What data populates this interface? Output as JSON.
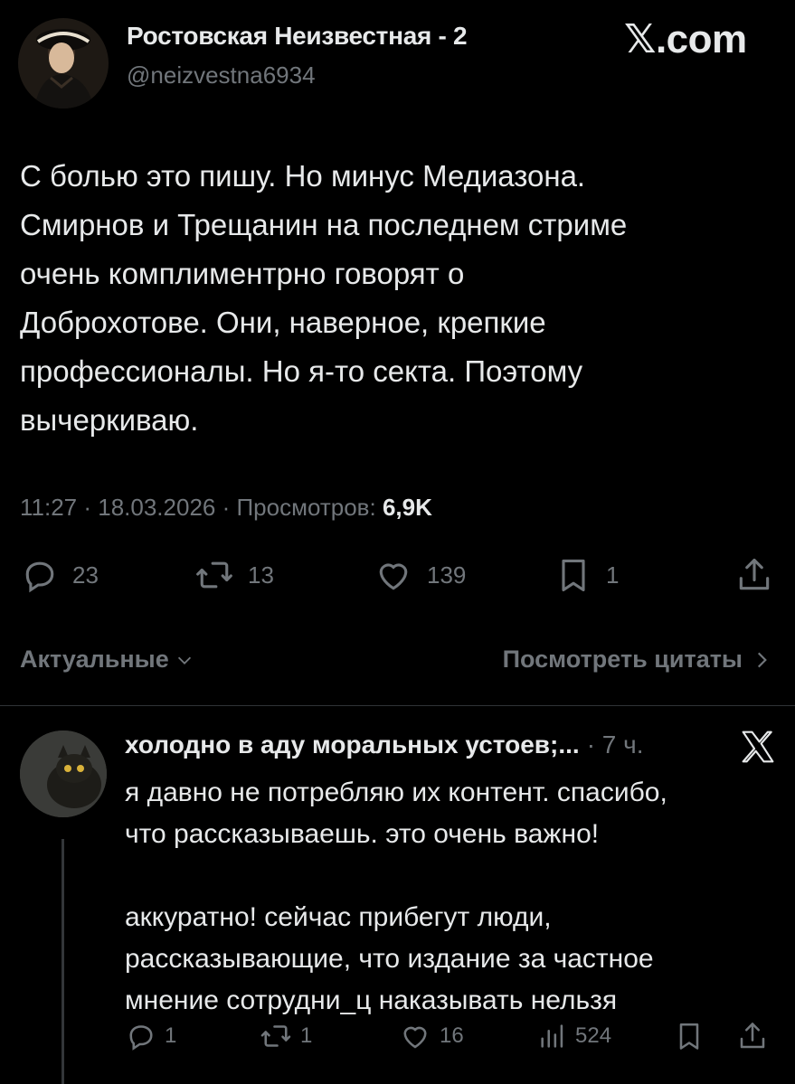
{
  "post": {
    "author_name": "Ростовская Неизвестная - 2",
    "author_handle": "@neizvestna6934",
    "brand": "𝕏.com",
    "text": "С болью это пишу. Но минус Медиазона.\nСмирнов и Трещанин на последнем стриме\nочень комплиментрно говорят о\nДоброхотове. Они, наверное, крепкие\nпрофессионалы. Но я-то секта. Поэтому\nвычеркиваю.",
    "timestamp": "11:27 · 18.03.2026 · Просмотров:",
    "views": "6,9K",
    "actions": {
      "replies": "23",
      "reposts": "13",
      "likes": "139",
      "bookmarks": "1"
    }
  },
  "controls": {
    "sort_label": "Актуальные",
    "quotes_link": "Посмотреть цитаты"
  },
  "reply": {
    "author_name": "холодно в аду моральных устоев;...",
    "time": "· 7 ч.",
    "text": "я давно не потребляю их контент. спасибо,\nчто рассказываешь. это очень важно!\n\nаккуратно! сейчас прибегут люди,\nрассказывающие, что издание за частное\nмнение сотрудни_ц наказывать нельзя",
    "actions": {
      "replies": "1",
      "reposts": "1",
      "likes": "16",
      "views": "524"
    }
  },
  "colors": {
    "background": "#000000",
    "text": "#e7e9ea",
    "secondary": "#71767b",
    "divider": "#2f3336"
  }
}
